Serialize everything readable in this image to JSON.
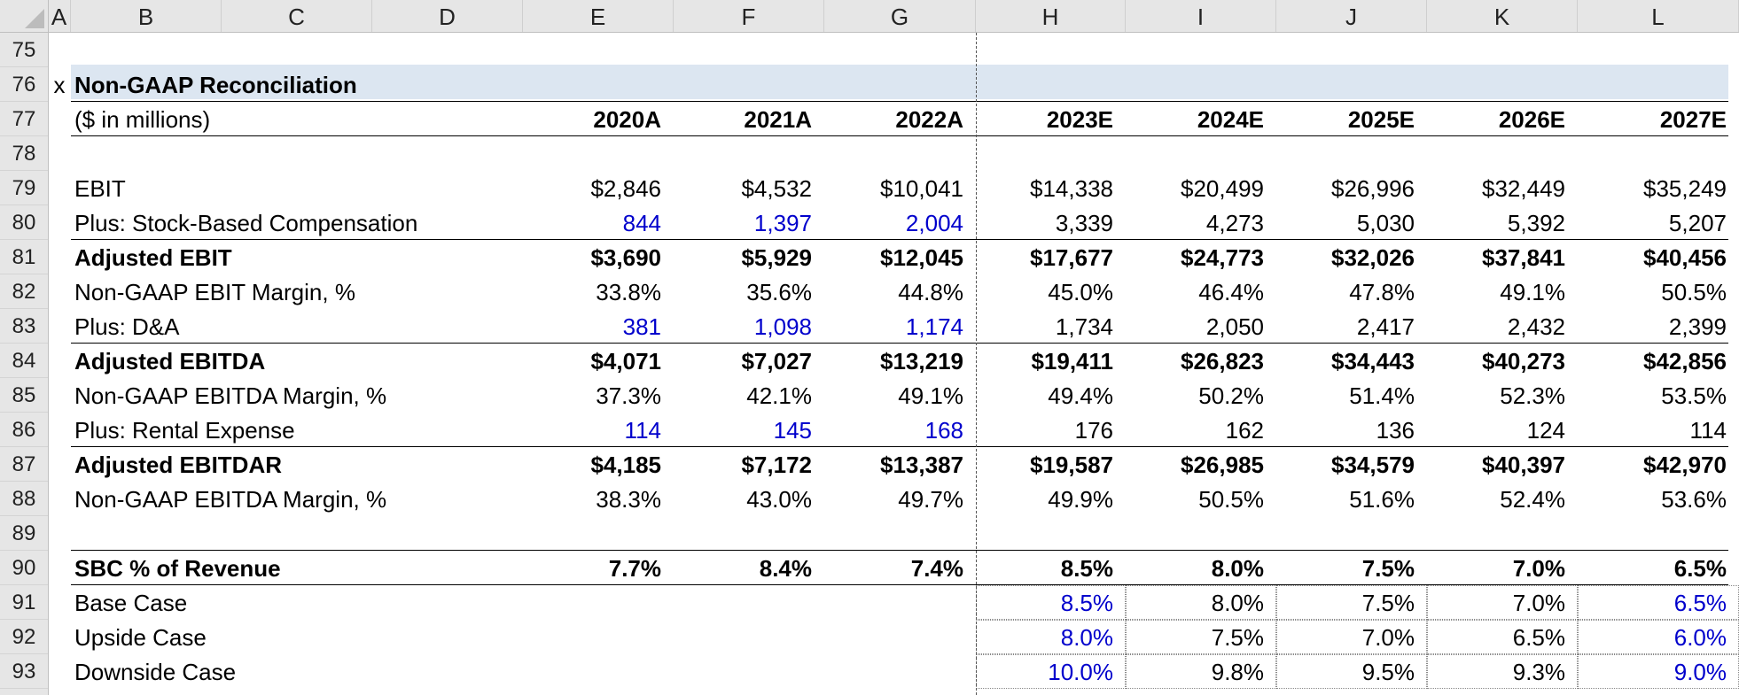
{
  "sheet": {
    "corner_icon": "select-all-triangle",
    "columns": [
      "A",
      "B",
      "C",
      "D",
      "E",
      "F",
      "G",
      "H",
      "I",
      "J",
      "K",
      "L"
    ],
    "rows": [
      "75",
      "76",
      "77",
      "78",
      "79",
      "80",
      "81",
      "82",
      "83",
      "84",
      "85",
      "86",
      "87",
      "88",
      "89",
      "90",
      "91",
      "92",
      "93"
    ],
    "marker": "x",
    "title": "Non-GAAP Reconciliation",
    "units": "($ in millions)",
    "years": [
      "2020A",
      "2021A",
      "2022A",
      "2023E",
      "2024E",
      "2025E",
      "2026E",
      "2027E"
    ],
    "colors": {
      "input_blue": "#0000cc",
      "title_band": "#dce6f1"
    },
    "lines": [
      {
        "row": 79,
        "label": "EBIT",
        "bold": false,
        "values": [
          "$2,846",
          "$4,532",
          "$10,041",
          "$14,338",
          "$20,499",
          "$26,996",
          "$32,449",
          "$35,249"
        ],
        "blue": []
      },
      {
        "row": 80,
        "label": "Plus: Stock-Based Compensation",
        "bold": false,
        "values": [
          "844",
          "1,397",
          "2,004",
          "3,339",
          "4,273",
          "5,030",
          "5,392",
          "5,207"
        ],
        "blue": [
          0,
          1,
          2
        ]
      },
      {
        "row": 81,
        "label": "Adjusted EBIT",
        "bold": true,
        "values": [
          "$3,690",
          "$5,929",
          "$12,045",
          "$17,677",
          "$24,773",
          "$32,026",
          "$37,841",
          "$40,456"
        ],
        "blue": []
      },
      {
        "row": 82,
        "label": "Non-GAAP EBIT Margin, %",
        "bold": false,
        "values": [
          "33.8%",
          "35.6%",
          "44.8%",
          "45.0%",
          "46.4%",
          "47.8%",
          "49.1%",
          "50.5%"
        ],
        "blue": []
      },
      {
        "row": 83,
        "label": "Plus: D&A",
        "bold": false,
        "values": [
          "381",
          "1,098",
          "1,174",
          "1,734",
          "2,050",
          "2,417",
          "2,432",
          "2,399"
        ],
        "blue": [
          0,
          1,
          2
        ]
      },
      {
        "row": 84,
        "label": "Adjusted EBITDA",
        "bold": true,
        "values": [
          "$4,071",
          "$7,027",
          "$13,219",
          "$19,411",
          "$26,823",
          "$34,443",
          "$40,273",
          "$42,856"
        ],
        "blue": []
      },
      {
        "row": 85,
        "label": "Non-GAAP EBITDA Margin, %",
        "bold": false,
        "values": [
          "37.3%",
          "42.1%",
          "49.1%",
          "49.4%",
          "50.2%",
          "51.4%",
          "52.3%",
          "53.5%"
        ],
        "blue": []
      },
      {
        "row": 86,
        "label": "Plus: Rental Expense",
        "bold": false,
        "values": [
          "114",
          "145",
          "168",
          "176",
          "162",
          "136",
          "124",
          "114"
        ],
        "blue": [
          0,
          1,
          2
        ]
      },
      {
        "row": 87,
        "label": "Adjusted EBITDAR",
        "bold": true,
        "values": [
          "$4,185",
          "$7,172",
          "$13,387",
          "$19,587",
          "$26,985",
          "$34,579",
          "$40,397",
          "$42,970"
        ],
        "blue": []
      },
      {
        "row": 88,
        "label": "Non-GAAP EBITDA Margin, %",
        "bold": false,
        "values": [
          "38.3%",
          "43.0%",
          "49.7%",
          "49.9%",
          "50.5%",
          "51.6%",
          "52.4%",
          "53.6%"
        ],
        "blue": []
      },
      {
        "row": 90,
        "label": "SBC % of Revenue",
        "bold": true,
        "values": [
          "7.7%",
          "8.4%",
          "7.4%",
          "8.5%",
          "8.0%",
          "7.5%",
          "7.0%",
          "6.5%"
        ],
        "blue": []
      }
    ],
    "cases": [
      {
        "row": 91,
        "label": "Base Case",
        "values": [
          "8.5%",
          "8.0%",
          "7.5%",
          "7.0%",
          "6.5%"
        ],
        "blue": [
          0,
          4
        ]
      },
      {
        "row": 92,
        "label": "Upside Case",
        "values": [
          "8.0%",
          "7.5%",
          "7.0%",
          "6.5%",
          "6.0%"
        ],
        "blue": [
          0,
          4
        ]
      },
      {
        "row": 93,
        "label": "Downside Case",
        "values": [
          "10.0%",
          "9.8%",
          "9.5%",
          "9.3%",
          "9.0%"
        ],
        "blue": [
          0,
          4
        ]
      }
    ]
  }
}
